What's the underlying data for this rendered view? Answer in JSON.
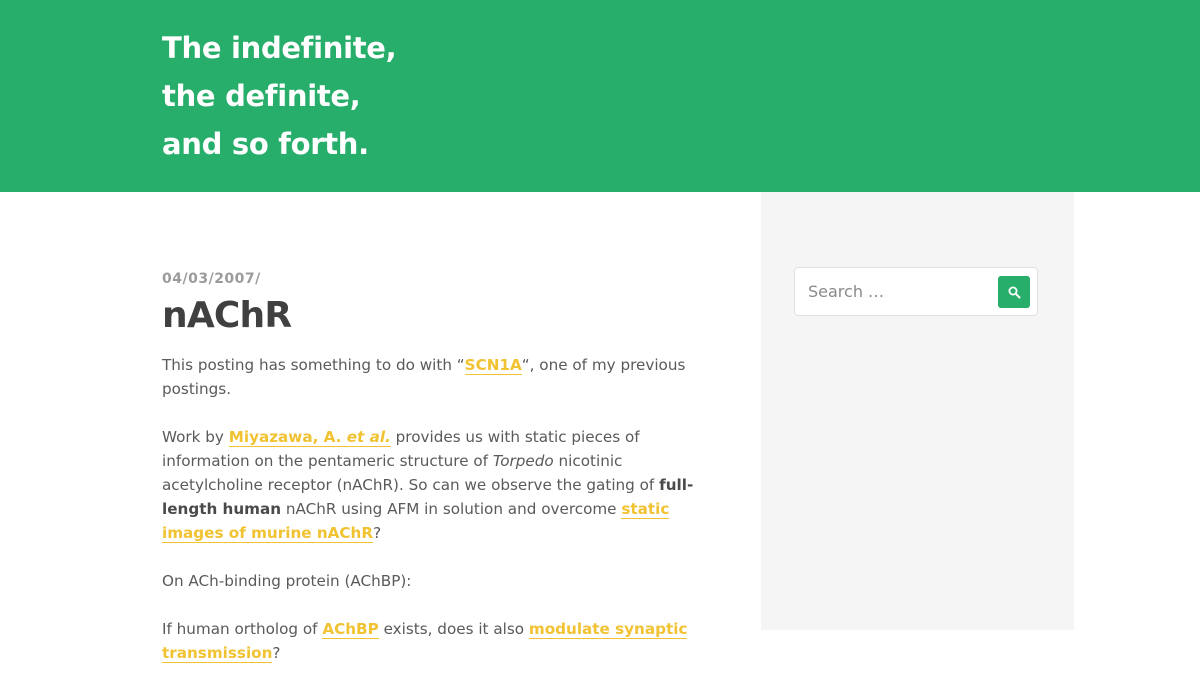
{
  "site": {
    "title_lines": [
      "The indefinite,",
      "the definite,",
      "and so forth."
    ],
    "header_color": "#27ae6a",
    "link_color": "#f1c232"
  },
  "post": {
    "date": "04/03/2007",
    "date_separator": "/",
    "title": "nAChR",
    "p1": {
      "before": "This posting has something to do with “",
      "link": "SCN1A",
      "after": "“, one of my previous postings."
    },
    "p2": {
      "t1": "Work by ",
      "link1_main": "Miyazawa, A. ",
      "link1_em": "et al.",
      "t2": " provides us with static pieces of information on the pentameric structure of ",
      "em1": "Torpedo",
      "t3": " nicotinic acetylcholine receptor (nAChR). So can we observe the gating of ",
      "strong1": "full-length human",
      "t4": " nAChR using AFM in solution and overcome ",
      "link2": "static images of murine nAChR",
      "t5": "?"
    },
    "p3": "On ACh-binding protein (AChBP):",
    "p4": {
      "t1": "If human ortholog of ",
      "link1": "AChBP",
      "t2": " exists, does it also ",
      "link2": "modulate synaptic transmission",
      "t3": "?"
    }
  },
  "sidebar": {
    "search": {
      "placeholder": "Search …",
      "button_icon": "search-icon"
    }
  }
}
